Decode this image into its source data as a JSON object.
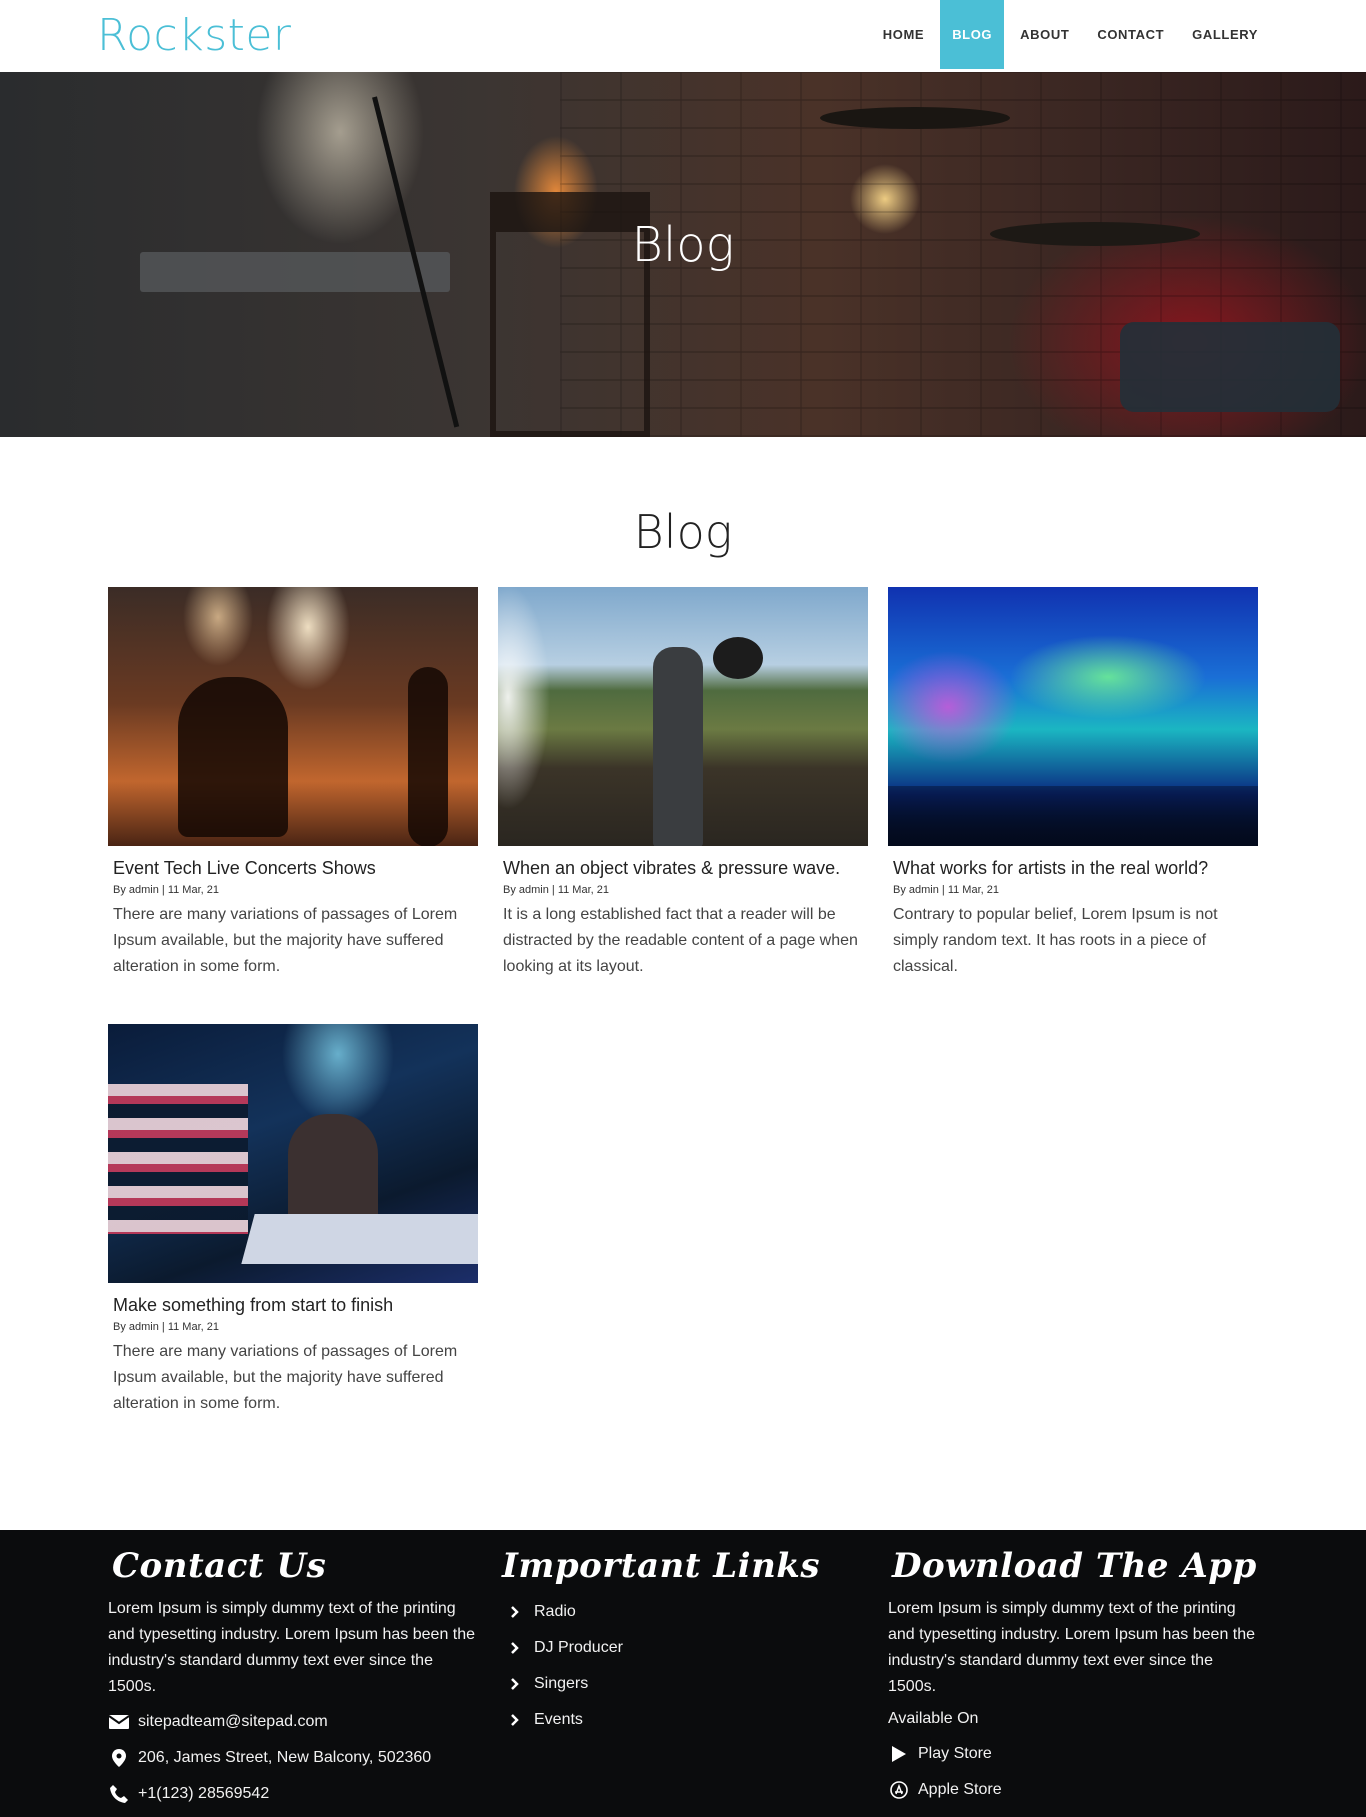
{
  "header": {
    "logo": "Rockster",
    "nav": [
      {
        "label": "HOME",
        "active": false
      },
      {
        "label": "BLOG",
        "active": true
      },
      {
        "label": "ABOUT",
        "active": false
      },
      {
        "label": "CONTACT",
        "active": false
      },
      {
        "label": "GALLERY",
        "active": false
      }
    ]
  },
  "hero": {
    "title": "Blog"
  },
  "section": {
    "title": "Blog"
  },
  "posts": [
    {
      "title": "Event Tech Live Concerts Shows",
      "meta": "By admin | 11 Mar, 21",
      "excerpt": "There are many variations of passages of Lorem Ipsum available, but the majority have suffered alteration in some form."
    },
    {
      "title": "When an object vibrates & pressure wave.",
      "meta": "By admin | 11 Mar, 21",
      "excerpt": "It is a long established fact that a reader will be distracted by the readable content of a page when looking at its layout."
    },
    {
      "title": "What works for artists in the real world?",
      "meta": "By admin | 11 Mar, 21",
      "excerpt": "Contrary to popular belief, Lorem Ipsum is not simply random text. It has roots in a piece of classical."
    },
    {
      "title": "Make something from start to finish",
      "meta": "By admin | 11 Mar, 21",
      "excerpt": "There are many variations of passages of Lorem Ipsum available, but the majority have suffered alteration in some form."
    }
  ],
  "footer": {
    "contact": {
      "title": "Contact Us",
      "text": "Lorem Ipsum is simply dummy text of the printing and typesetting industry. Lorem Ipsum has been the industry's standard dummy text ever since the 1500s.",
      "email": "sitepadteam@sitepad.com",
      "address": "206, James Street, New Balcony, 502360",
      "phone": "+1(123) 28569542"
    },
    "links": {
      "title": "Important Links",
      "items": [
        "Radio",
        "DJ Producer",
        "Singers",
        "Events"
      ]
    },
    "app": {
      "title": "Download The App",
      "text": "Lorem Ipsum is simply dummy text of the printing and typesetting industry. Lorem Ipsum has been the industry's standard dummy text ever since the 1500s.",
      "available": "Available On",
      "play_store": "Play Store",
      "apple_store": "Apple Store"
    }
  },
  "colors": {
    "accent": "#4bbfd6",
    "footer_bg": "#0b0c0d"
  },
  "icons": [
    "envelope-icon",
    "map-pin-icon",
    "phone-icon",
    "chevron-right-icon",
    "play-store-icon",
    "apple-store-icon"
  ]
}
